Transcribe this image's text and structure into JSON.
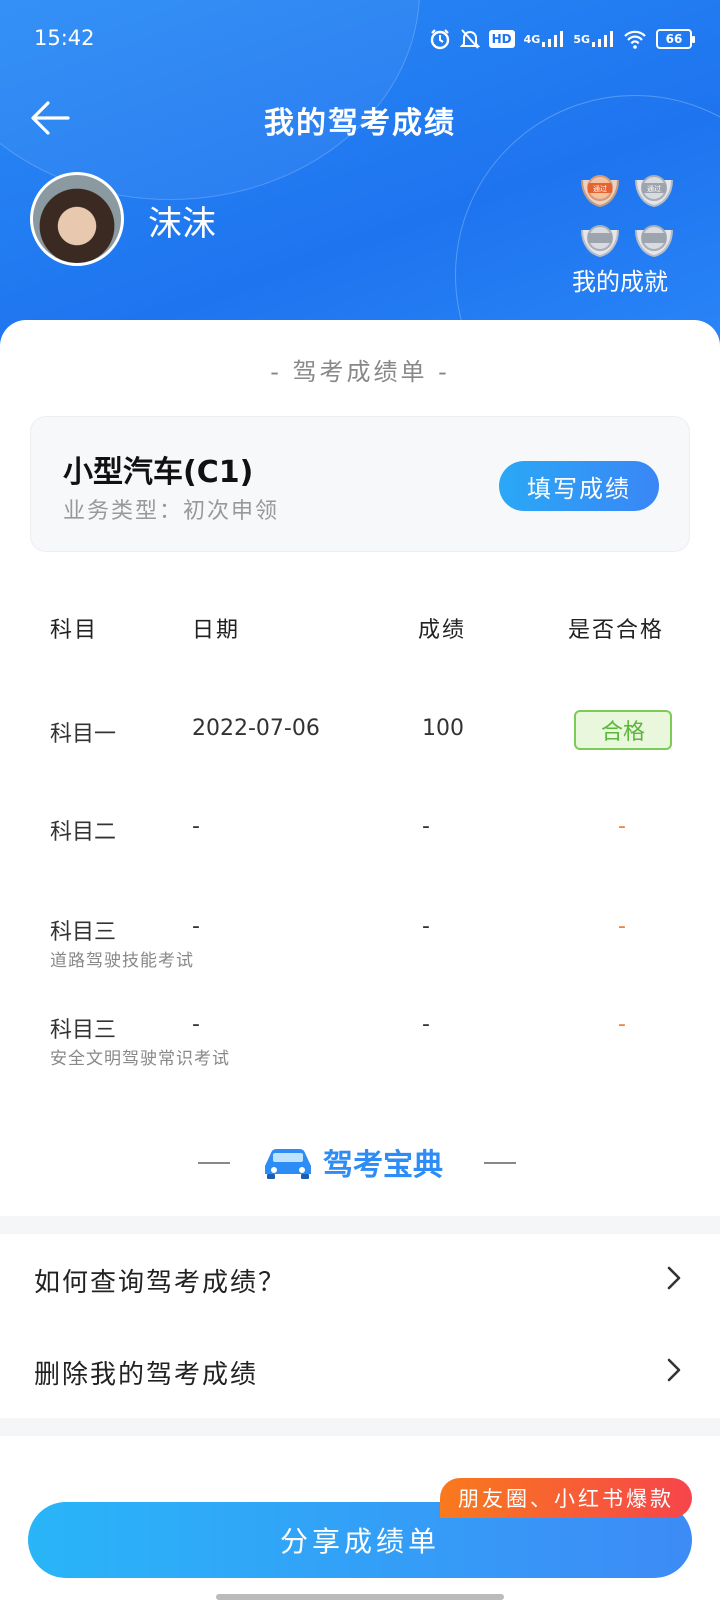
{
  "status_bar": {
    "time": "15:42",
    "battery": "66",
    "net1": "4G",
    "net2": "5G",
    "hd": "HD"
  },
  "header": {
    "title": "我的驾考成绩",
    "username": "沫沫",
    "achievements_label": "我的成就",
    "medal_text": "通过"
  },
  "sheet": {
    "title": "- 驾考成绩单 -",
    "license_name": "小型汽车(C1)",
    "business_type": "业务类型：初次申领",
    "fill_button": "填写成绩",
    "columns": [
      "科目",
      "日期",
      "成绩",
      "是否合格"
    ],
    "rows": [
      {
        "subject": "科目一",
        "sub": "",
        "date": "2022-07-06",
        "score": "100",
        "result": "合格"
      },
      {
        "subject": "科目二",
        "sub": "",
        "date": "-",
        "score": "-",
        "result": "-"
      },
      {
        "subject": "科目三",
        "sub": "道路驾驶技能考试",
        "date": "-",
        "score": "-",
        "result": "-"
      },
      {
        "subject": "科目三",
        "sub": "安全文明驾驶常识考试",
        "date": "-",
        "score": "-",
        "result": "-"
      }
    ],
    "brand": "驾考宝典"
  },
  "links": [
    {
      "label": "如何查询驾考成绩？"
    },
    {
      "label": "删除我的驾考成绩"
    }
  ],
  "share": {
    "label": "分享成绩单",
    "badge": "朋友圈、小红书爆款"
  },
  "colors": {
    "primary": "#1e74ef",
    "pass_green": "#5cb63a",
    "dash_orange": "#f0843c",
    "badge_orange": "#f97a1d"
  }
}
